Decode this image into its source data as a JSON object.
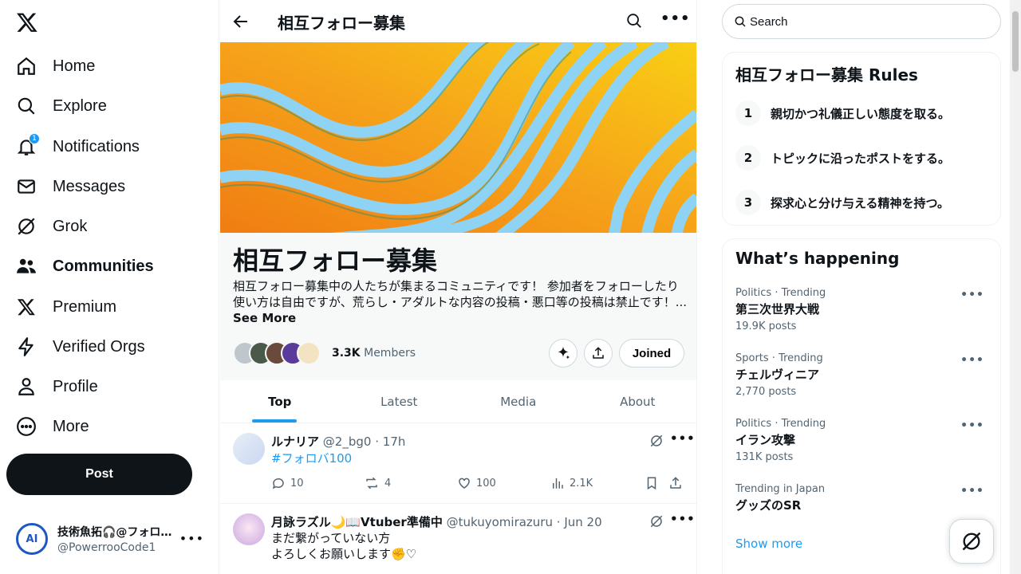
{
  "nav": {
    "items": [
      {
        "label": "Home",
        "icon": "home-icon"
      },
      {
        "label": "Explore",
        "icon": "search-icon"
      },
      {
        "label": "Notifications",
        "icon": "bell-icon",
        "badge": "1"
      },
      {
        "label": "Messages",
        "icon": "envelope-icon"
      },
      {
        "label": "Grok",
        "icon": "grok-icon"
      },
      {
        "label": "Communities",
        "icon": "communities-icon",
        "active": true
      },
      {
        "label": "Premium",
        "icon": "x-logo-icon"
      },
      {
        "label": "Verified Orgs",
        "icon": "lightning-icon"
      },
      {
        "label": "Profile",
        "icon": "person-icon"
      },
      {
        "label": "More",
        "icon": "more-circle-icon"
      }
    ],
    "post_label": "Post"
  },
  "account": {
    "avatar_text": "AI",
    "name": "技術魚拓🎧@フォロ…",
    "handle": "@PowerrooCode1"
  },
  "header": {
    "title": "相互フォロー募集"
  },
  "community": {
    "name": "相互フォロー募集",
    "description_line1": "相互フォロー募集中の人たちが集まるコミュニティです！ 参加者をフォローしたり",
    "description_line2": "使い方は自由ですが、荒らし・アダルトな内容の投稿・悪口等の投稿は禁止です！...",
    "see_more": "See More",
    "member_count": "3.3K",
    "members_label": "Members",
    "joined_label": "Joined"
  },
  "tabs": [
    "Top",
    "Latest",
    "Media",
    "About"
  ],
  "tweets": [
    {
      "name": "ルナリア",
      "handle": "@2_bg0",
      "time": "17h",
      "body": "#フォロバ100",
      "replies": "10",
      "retweets": "4",
      "likes": "100",
      "views": "2.1K"
    },
    {
      "name": "月詠ラズル🌙📖Vtuber準備中",
      "handle": "@tukuyomirazuru",
      "time": "Jun 20",
      "body_line1": "まだ繋がっていない方",
      "body_line2": "よろしくお願いします✊♡"
    }
  ],
  "search": {
    "placeholder": "Search"
  },
  "rules": {
    "title": "相互フォロー募集 Rules",
    "items": [
      {
        "num": "1",
        "text": "親切かつ礼儀正しい態度を取る。"
      },
      {
        "num": "2",
        "text": "トピックに沿ったポストをする。"
      },
      {
        "num": "3",
        "text": "探求心と分け与える精神を持つ。"
      }
    ]
  },
  "trends": {
    "title": "What’s happening",
    "items": [
      {
        "context": "Politics · Trending",
        "name": "第三次世界大戦",
        "count": "19.9K posts"
      },
      {
        "context": "Sports · Trending",
        "name": "チェルヴィニア",
        "count": "2,770 posts"
      },
      {
        "context": "Politics · Trending",
        "name": "イラン攻撃",
        "count": "131K posts"
      },
      {
        "context": "Trending in Japan",
        "name": "グッズのSR",
        "count": ""
      }
    ],
    "show_more": "Show more"
  },
  "colors": {
    "accent": "#1d9bf0",
    "text": "#0f1419",
    "muted": "#536471",
    "banner_orange": "#f7941d",
    "banner_yellow": "#f9c80e",
    "banner_blue": "#8fd3f4"
  }
}
